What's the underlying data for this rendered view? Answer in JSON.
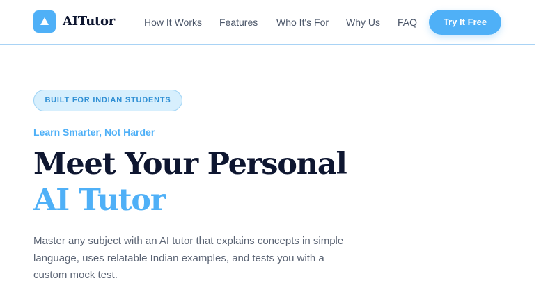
{
  "brand": {
    "name": "AITutor",
    "logo_icon": "triangle-up-icon",
    "accent_color": "#4fb0f7"
  },
  "nav": {
    "links": [
      "How It Works",
      "Features",
      "Who It's For",
      "Why Us",
      "FAQ"
    ],
    "cta_label": "Try It Free"
  },
  "hero": {
    "badge": "BUILT FOR INDIAN STUDENTS",
    "tagline": "Learn Smarter, Not Harder",
    "headline_line1": "Meet Your Personal",
    "headline_line2": "AI Tutor",
    "description": "Master any subject with an AI tutor that explains concepts in simple language, uses relatable Indian examples, and tests you with a custom mock test."
  }
}
